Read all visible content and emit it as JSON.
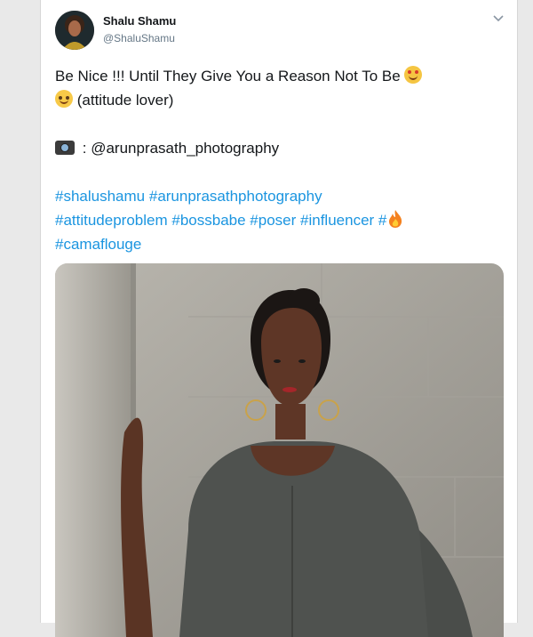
{
  "tweet": {
    "author_name": "Shalu Shamu",
    "author_handle": "@ShaluShamu",
    "line1": "Be Nice !!! Until They Give You a Reason Not To Be",
    "line2": "(attitude lover)",
    "credit_prefix": ":",
    "credit_mention": "@arunprasath_photography",
    "hashtags": {
      "h1": "#shalushamu",
      "h2": "#arunprasathphotography",
      "h3": "#attitudeproblem",
      "h4": "#bossbabe",
      "h5": "#poser",
      "h6": "#influencer",
      "h7": "#",
      "h8": "#camaflouge"
    }
  },
  "icons": {
    "caret": "chevron-down-icon",
    "star_eyes": "star-struck-emoji",
    "sweat_smile": "sweat-smile-emoji",
    "camera": "camera-flash-emoji",
    "fire": "fire-emoji"
  },
  "colors": {
    "hashtag": "#1b95e0",
    "text": "#14171a",
    "handle": "#657786"
  }
}
